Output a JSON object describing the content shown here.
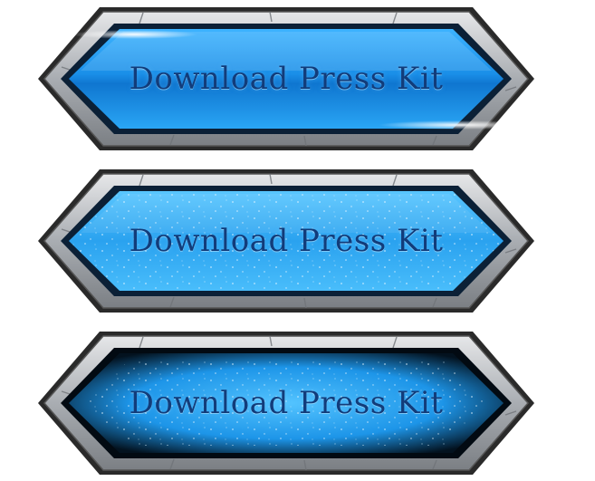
{
  "buttons": [
    {
      "state": "normal",
      "label": "Download Press Kit"
    },
    {
      "state": "hover",
      "label": "Download Press Kit"
    },
    {
      "state": "pressed",
      "label": "Download Press Kit"
    }
  ],
  "colors": {
    "frame_stone": "#b9bcc0",
    "frame_dark": "#1a1a1a",
    "panel_blue": "#1c8fe6",
    "panel_light": "#5fc8ff",
    "label_text": "#123c7a",
    "background": "#ffffff"
  }
}
